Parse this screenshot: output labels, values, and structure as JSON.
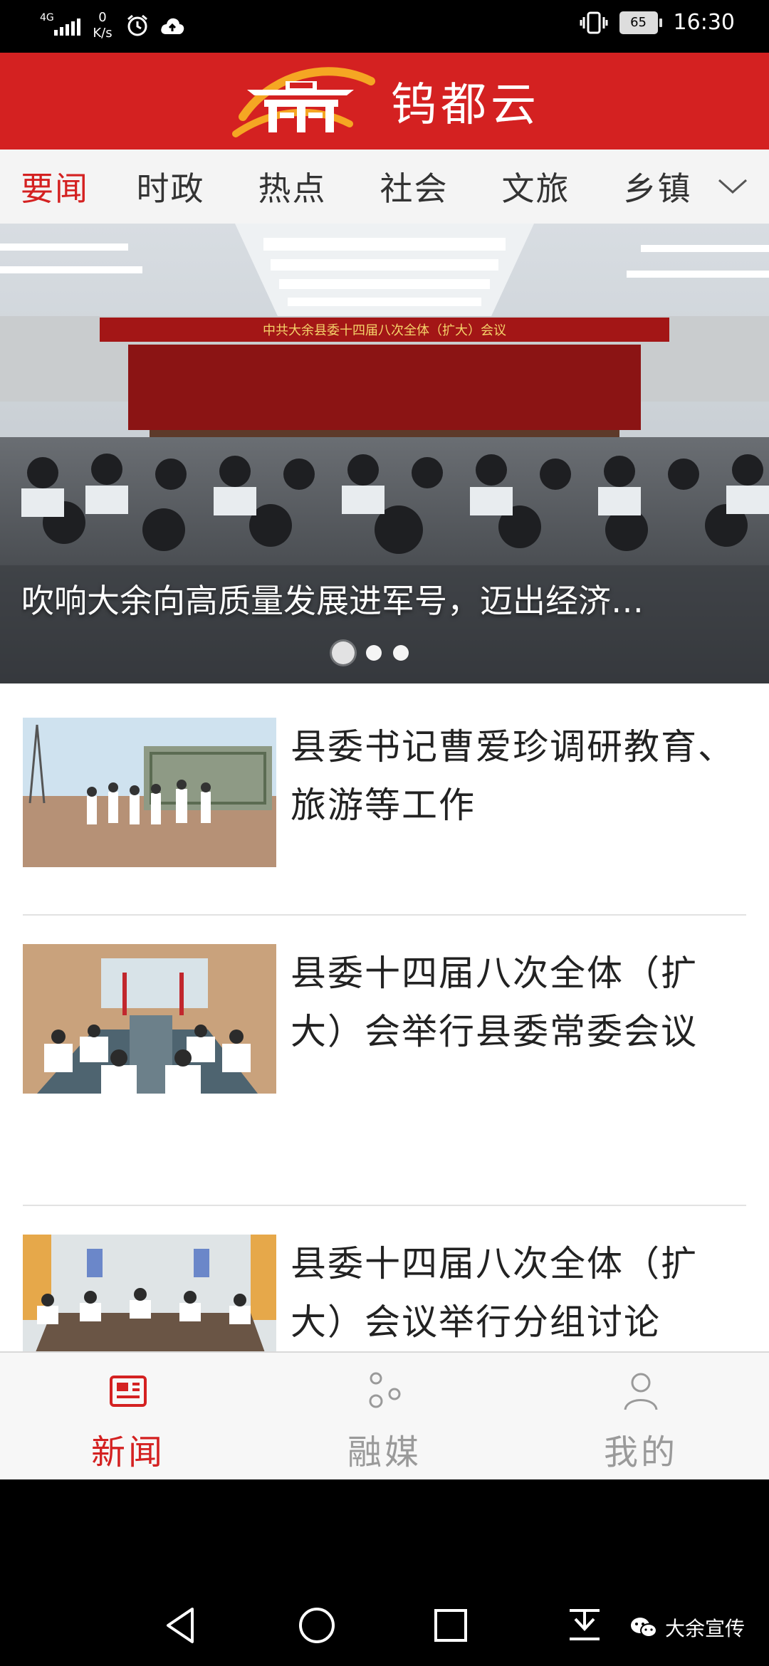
{
  "status_bar": {
    "network": "4G",
    "speed_value": "0",
    "speed_unit": "K/s",
    "battery": "65",
    "time": "16:30"
  },
  "header": {
    "app_name": "钨都云"
  },
  "tabs": [
    {
      "label": "要闻"
    },
    {
      "label": "时政"
    },
    {
      "label": "热点"
    },
    {
      "label": "社会"
    },
    {
      "label": "文旅"
    },
    {
      "label": "乡镇"
    }
  ],
  "banner": {
    "title": "吹响大余向高质量发展进军号，迈出经济…",
    "slide_count": 3,
    "active_slide": 1,
    "backdrop_text": "中共大余县委十四届八次全体（扩大）会议"
  },
  "news": [
    {
      "title": " 县委书记曹爱珍调研教育、旅游等工作"
    },
    {
      "title": "  县委十四届八次全体（扩大）会举行县委常委会议"
    },
    {
      "title": " 县委十四届八次全体（扩大）会议举行分组讨论"
    }
  ],
  "bottom_nav": [
    {
      "label": "新闻",
      "icon": "news-icon",
      "active": true
    },
    {
      "label": "融媒",
      "icon": "media-icon",
      "active": false
    },
    {
      "label": "我的",
      "icon": "user-icon",
      "active": false
    }
  ],
  "watermark": "大余宣传",
  "colors": {
    "brand_red": "#d42121",
    "inactive_gray": "#999999"
  }
}
